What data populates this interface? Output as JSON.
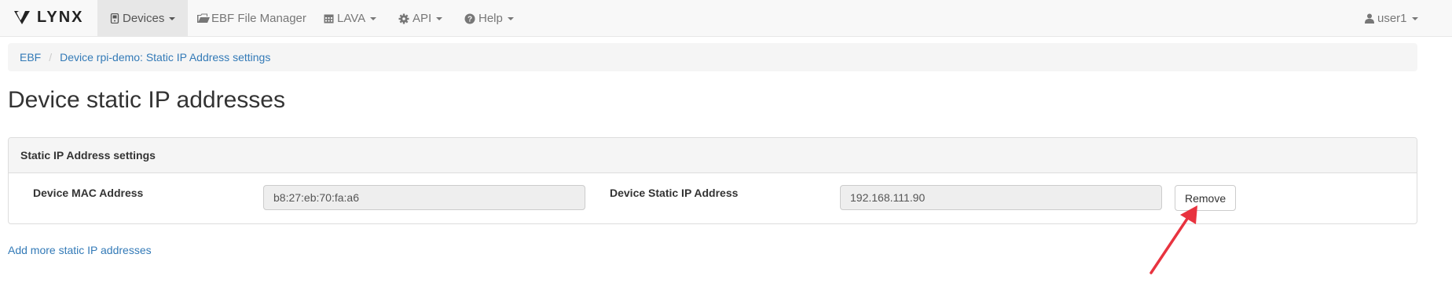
{
  "navbar": {
    "brand": "LYNX",
    "items": [
      {
        "label": "Devices",
        "icon": "device-icon",
        "active": true
      },
      {
        "label": "EBF File Manager",
        "icon": "folder-open-icon"
      },
      {
        "label": "LAVA",
        "icon": "calendar-icon"
      },
      {
        "label": "API",
        "icon": "gear-icon"
      },
      {
        "label": "Help",
        "icon": "question-circle-icon"
      }
    ],
    "user": {
      "label": "user1",
      "icon": "user-icon"
    }
  },
  "breadcrumb": [
    {
      "label": "EBF"
    },
    {
      "label": "Device rpi-demo: Static IP Address settings"
    }
  ],
  "page_title": "Device static IP addresses",
  "panel": {
    "heading": "Static IP Address settings",
    "mac_label": "Device MAC Address",
    "mac_value": "b8:27:eb:70:fa:a6",
    "ip_label": "Device Static IP Address",
    "ip_value": "192.168.111.90",
    "remove_label": "Remove"
  },
  "add_link": "Add more static IP addresses",
  "colors": {
    "link": "#337ab7",
    "navbar_bg": "#f8f8f8",
    "annotation_arrow": "#e8333f"
  }
}
